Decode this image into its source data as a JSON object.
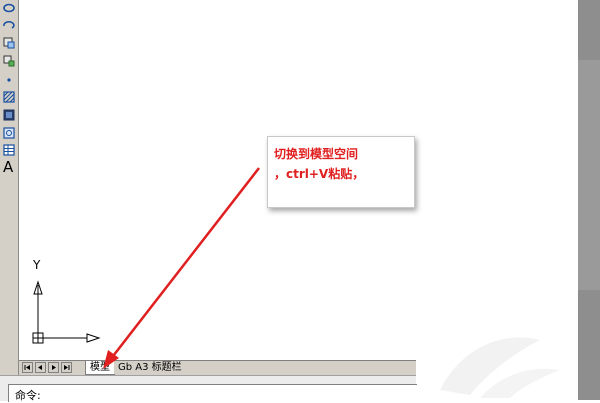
{
  "toolbar": {
    "tools": [
      {
        "icon": "ellipse-icon"
      },
      {
        "icon": "ellipse-arc-icon"
      },
      {
        "icon": "insert-block-icon"
      },
      {
        "icon": "make-block-icon"
      },
      {
        "icon": "point-icon"
      },
      {
        "icon": "hatch-icon"
      },
      {
        "icon": "gradient-icon"
      },
      {
        "icon": "region-icon"
      },
      {
        "icon": "table-icon"
      }
    ],
    "text_tool_label": "A"
  },
  "canvas": {
    "ucs_y_label": "Y"
  },
  "tabs": {
    "model": "模型",
    "layout": "Gb A3 标题栏"
  },
  "command": {
    "label": "命令:"
  },
  "callout": {
    "line1": "切换到模型空间",
    "line2": "，ctrl+V粘贴，"
  },
  "colors": {
    "annotation_red": "#e02020",
    "toolbar_bg": "#d4d0c8"
  }
}
